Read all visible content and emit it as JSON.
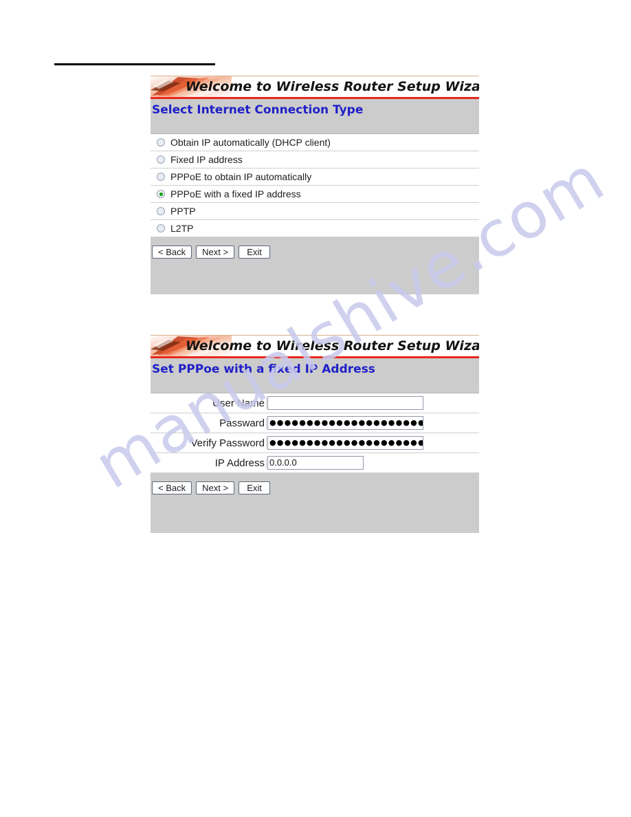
{
  "page": {
    "top_rule": "horizontal-rule"
  },
  "watermark": {
    "text": "manualshive.com"
  },
  "panels": [
    {
      "banner_title": "Welcome to Wireless Router Setup Wizard",
      "heading": "Select Internet Connection Type",
      "options": [
        {
          "label": "Obtain IP automatically (DHCP client)",
          "selected": false
        },
        {
          "label": "Fixed IP address",
          "selected": false
        },
        {
          "label": "PPPoE to obtain IP automatically",
          "selected": false
        },
        {
          "label": "PPPoE with a fixed IP address",
          "selected": true
        },
        {
          "label": "PPTP",
          "selected": false
        },
        {
          "label": "L2TP",
          "selected": false
        }
      ],
      "buttons": {
        "back": "< Back",
        "next": "Next >",
        "exit": "Exit"
      }
    },
    {
      "banner_title": "Welcome to Wireless Router Setup Wizard",
      "heading": "Set PPPoe with a fixed IP Address",
      "fields": [
        {
          "label": "User Name",
          "value": "",
          "type": "text"
        },
        {
          "label": "Passward",
          "value": "●●●●●●●●●●●●●●●●●●●●●●●●",
          "type": "password"
        },
        {
          "label": "Verify Password",
          "value": "●●●●●●●●●●●●●●●●●●●●●●●●",
          "type": "password"
        },
        {
          "label": "IP Address",
          "value": "0.0.0.0",
          "type": "text"
        }
      ],
      "buttons": {
        "back": "< Back",
        "next": "Next >",
        "exit": "Exit"
      }
    }
  ],
  "colors": {
    "panel_bg": "#cccccc",
    "heading_blue": "#2020c8",
    "banner_rule_red": "#e8281c",
    "radio_selected_green": "#12a012",
    "watermark_purple": "#c8c9ec"
  }
}
